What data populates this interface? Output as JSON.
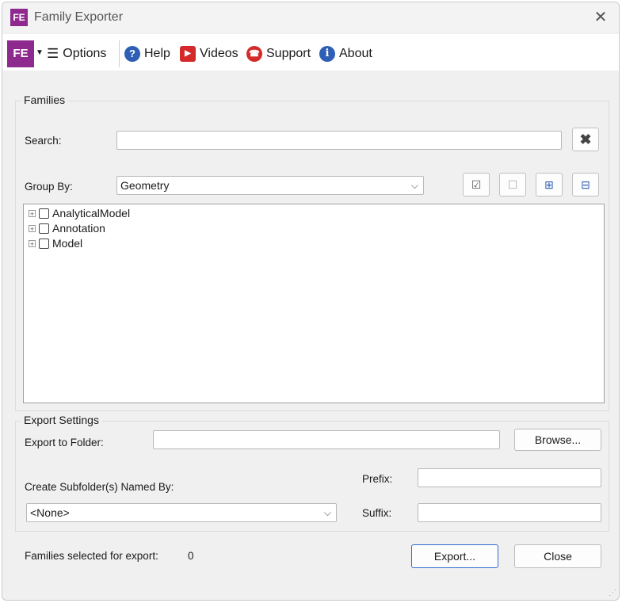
{
  "window": {
    "title": "Family Exporter",
    "logo_text": "FE"
  },
  "toolbar": {
    "logo_text": "FE",
    "options_label": "Options",
    "help_label": "Help",
    "videos_label": "Videos",
    "support_label": "Support",
    "about_label": "About"
  },
  "families": {
    "legend": "Families",
    "search_label": "Search:",
    "search_value": "",
    "group_by_label": "Group By:",
    "group_by_value": "Geometry",
    "tree": [
      {
        "label": "AnalyticalModel",
        "checked": false
      },
      {
        "label": "Annotation",
        "checked": false
      },
      {
        "label": "Model",
        "checked": false
      }
    ]
  },
  "export_settings": {
    "legend": "Export Settings",
    "folder_label": "Export to Folder:",
    "folder_value": "",
    "browse_label": "Browse...",
    "subfolder_label": "Create Subfolder(s) Named By:",
    "subfolder_value": "<None>",
    "prefix_label": "Prefix:",
    "prefix_value": "",
    "suffix_label": "Suffix:",
    "suffix_value": ""
  },
  "footer": {
    "selected_label": "Families selected for export:",
    "selected_count": "0",
    "export_label": "Export...",
    "close_label": "Close"
  },
  "colors": {
    "brand": "#8e2a8e",
    "help": "#2e5fb5",
    "videos": "#d42a2a",
    "support": "#d42a2a",
    "about": "#2e5fb5",
    "accent_border": "#2f6bd0"
  }
}
